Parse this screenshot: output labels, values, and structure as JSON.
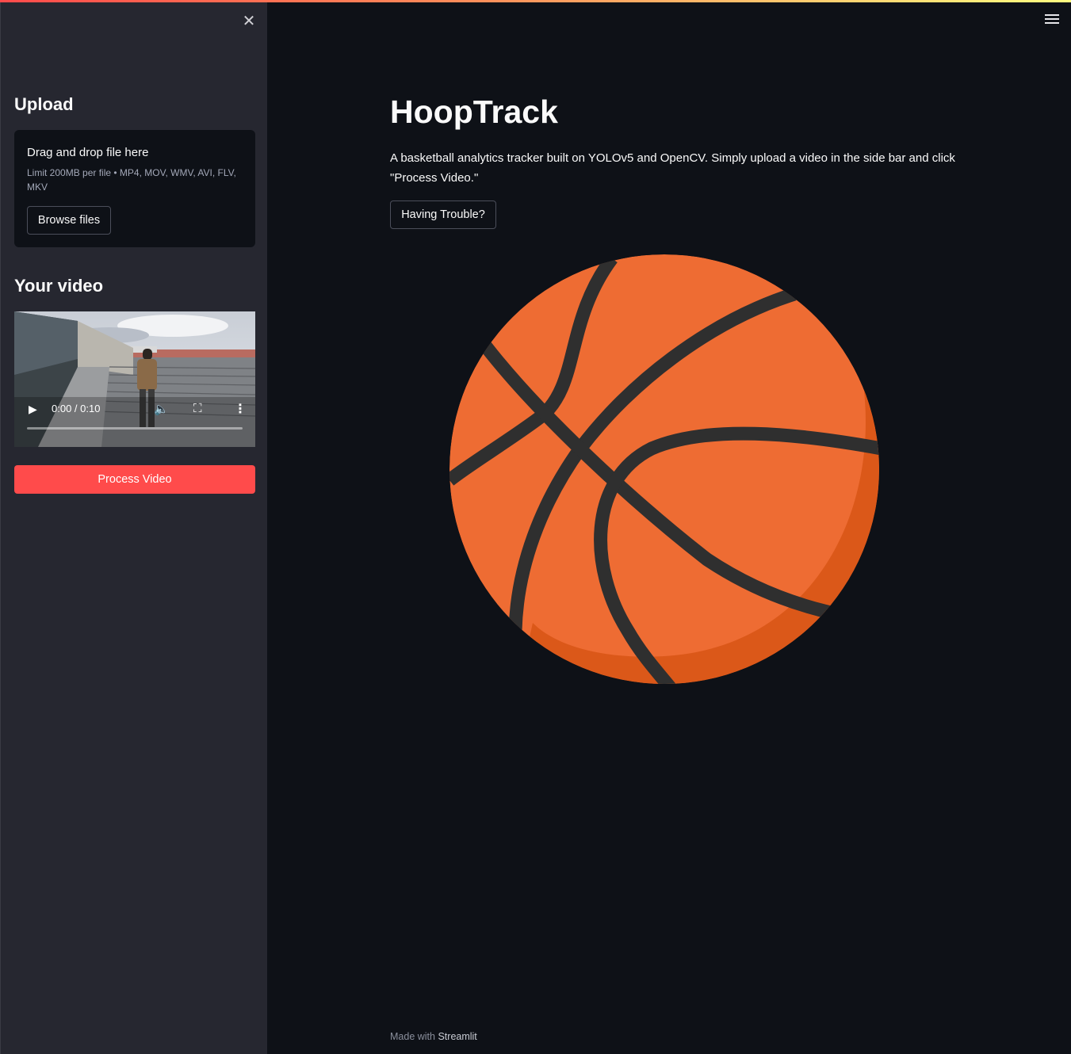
{
  "sidebar": {
    "upload_heading": "Upload",
    "dropzone": {
      "title": "Drag and drop file here",
      "limit": "Limit 200MB per file • MP4, MOV, WMV, AVI, FLV, MKV",
      "browse_label": "Browse files"
    },
    "video_heading": "Your video",
    "video": {
      "time": "0:00 / 0:10",
      "progress": 0.0
    },
    "process_label": "Process Video",
    "close_icon": "close-icon"
  },
  "main": {
    "title": "HoopTrack",
    "description": "A basketball analytics tracker built on YOLOv5 and OpenCV. Simply upload a video in the side bar and click \"Process Video.\"",
    "help_label": "Having Trouble?",
    "menu_icon": "hamburger-menu-icon",
    "image": "basketball-illustration"
  },
  "footer": {
    "made_with": "Made with",
    "brand": "Streamlit"
  },
  "colors": {
    "accent": "#ff4b4b",
    "background": "#0e1117",
    "sidebar": "#262730",
    "ball": "#ee6c33",
    "ball_shadow": "#db5819",
    "seams": "#2f2f2f"
  }
}
